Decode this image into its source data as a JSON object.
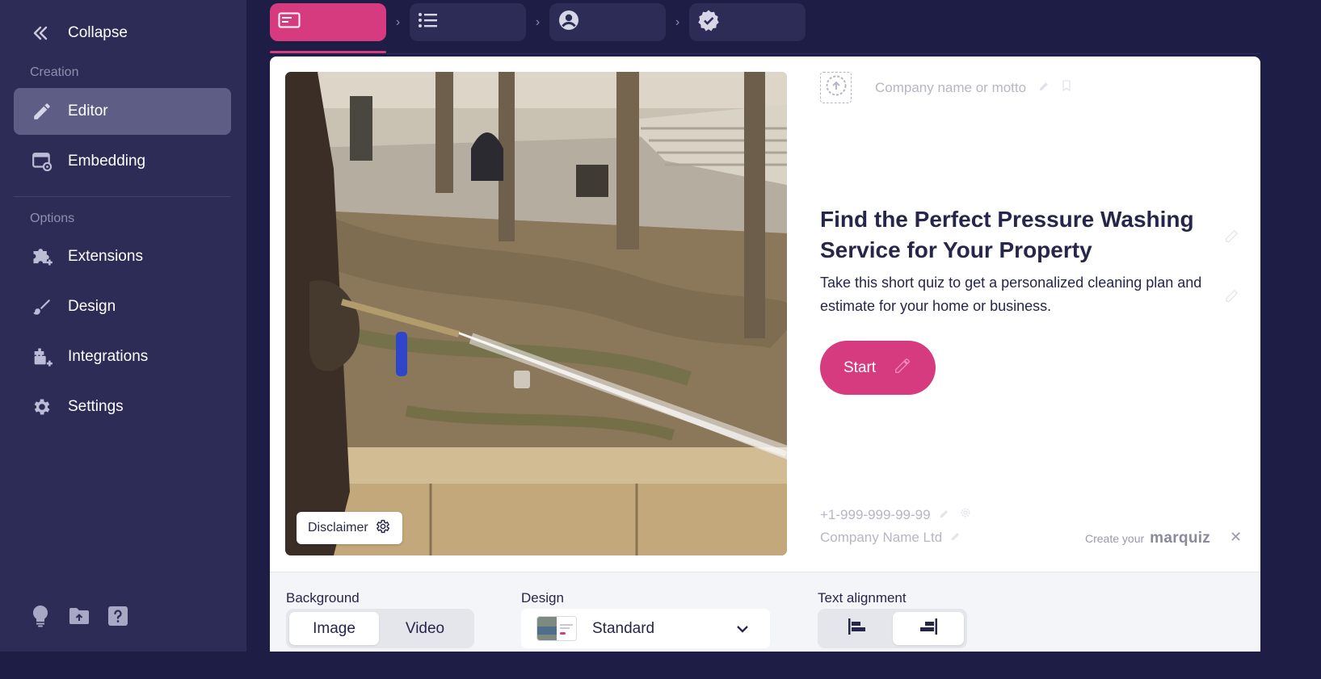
{
  "sidebar": {
    "collapse_label": "Collapse",
    "sections": {
      "creation": "Creation",
      "options": "Options"
    },
    "items": [
      {
        "label": "Editor",
        "icon": "pencil-icon",
        "active": true
      },
      {
        "label": "Embedding",
        "icon": "embed-icon"
      },
      {
        "label": "Extensions",
        "icon": "puzzle-plus-icon"
      },
      {
        "label": "Design",
        "icon": "brush-icon"
      },
      {
        "label": "Integrations",
        "icon": "plug-plus-icon"
      },
      {
        "label": "Settings",
        "icon": "gear-icon"
      }
    ],
    "bottom_icons": [
      "lightbulb-icon",
      "folder-upload-icon",
      "help-icon"
    ]
  },
  "steps": [
    {
      "icon": "start-page-icon",
      "active": true
    },
    {
      "icon": "list-icon"
    },
    {
      "icon": "user-icon"
    },
    {
      "icon": "verified-icon"
    }
  ],
  "preview": {
    "image": "pressure-washing-photo",
    "disclaimer": "Disclaimer",
    "motto_placeholder": "Company name or motto",
    "headline": "Find the Perfect Pressure Washing Service for Your Property",
    "subtitle": "Take this short quiz to get a personalized cleaning plan and estimate for your home or business.",
    "start_button": "Start",
    "phone": "+1-999-999-99-99",
    "company": "Company Name Ltd",
    "branding": {
      "prefix": "Create your",
      "name": "marquiz"
    }
  },
  "panel": {
    "background": {
      "label": "Background",
      "options": [
        "Image",
        "Video"
      ],
      "selected": "Image"
    },
    "design": {
      "label": "Design",
      "value": "Standard"
    },
    "text_alignment": {
      "label": "Text alignment",
      "options": [
        "align-left-icon",
        "align-right-icon"
      ],
      "selected": "align-right-icon"
    }
  },
  "colors": {
    "accent": "#d63b7f",
    "sidebar": "#2d2c56",
    "background": "#1e1d45",
    "active_nav": "#5e5d85"
  }
}
